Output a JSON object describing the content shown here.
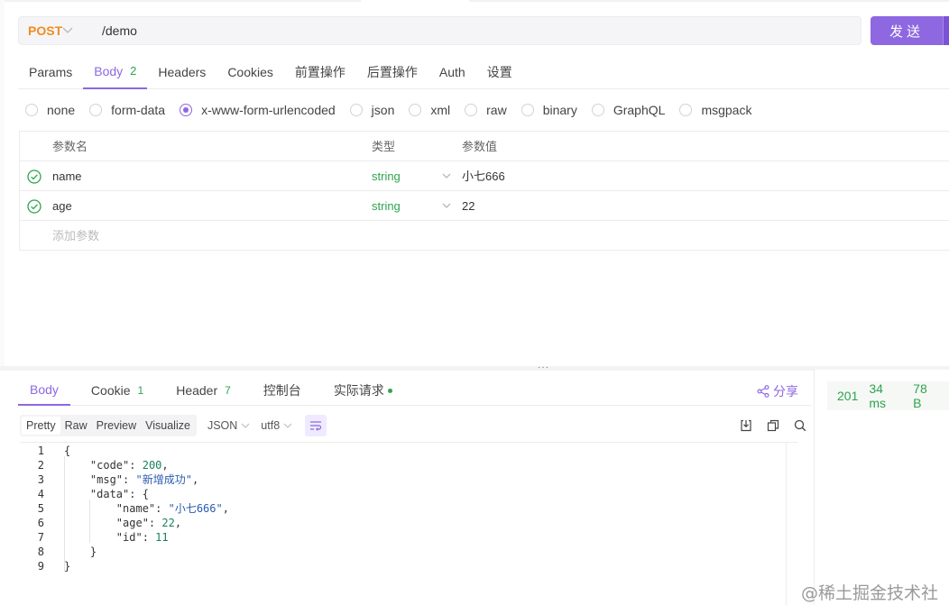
{
  "request": {
    "method": "POST",
    "url": "/demo",
    "send_label": "发送"
  },
  "req_tabs": [
    {
      "label": "Params",
      "count": ""
    },
    {
      "label": "Body",
      "count": "2",
      "active": true
    },
    {
      "label": "Headers",
      "count": ""
    },
    {
      "label": "Cookies",
      "count": ""
    },
    {
      "label": "前置操作",
      "count": ""
    },
    {
      "label": "后置操作",
      "count": ""
    },
    {
      "label": "Auth",
      "count": ""
    },
    {
      "label": "设置",
      "count": ""
    }
  ],
  "body_types": [
    "none",
    "form-data",
    "x-www-form-urlencoded",
    "json",
    "xml",
    "raw",
    "binary",
    "GraphQL",
    "msgpack"
  ],
  "body_type_selected": "x-www-form-urlencoded",
  "params_table": {
    "headers": {
      "name": "参数名",
      "type": "类型",
      "value": "参数值"
    },
    "rows": [
      {
        "name": "name",
        "type": "string",
        "value": "小七666"
      },
      {
        "name": "age",
        "type": "string",
        "value": "22"
      }
    ],
    "add_placeholder": "添加参数"
  },
  "res_tabs": [
    {
      "label": "Body",
      "count": "",
      "active": true
    },
    {
      "label": "Cookie",
      "count": "1"
    },
    {
      "label": "Header",
      "count": "7"
    },
    {
      "label": "控制台",
      "count": ""
    },
    {
      "label": "实际请求",
      "count": "",
      "dot": true
    }
  ],
  "share_label": "分享",
  "status": {
    "code": "201",
    "time": "34 ms",
    "size": "78 B"
  },
  "view_modes": [
    "Pretty",
    "Raw",
    "Preview",
    "Visualize"
  ],
  "view_mode_selected": "Pretty",
  "format_select": "JSON",
  "encoding_select": "utf8",
  "code_lines": [
    {
      "n": "1",
      "indent": 0,
      "text": "{"
    },
    {
      "n": "2",
      "indent": 1,
      "key": "\"code\"",
      "val": "200",
      "vtype": "num",
      "tail": ","
    },
    {
      "n": "3",
      "indent": 1,
      "key": "\"msg\"",
      "val": "\"新增成功\"",
      "vtype": "str",
      "tail": ","
    },
    {
      "n": "4",
      "indent": 1,
      "key": "\"data\"",
      "val": "{",
      "vtype": "punc",
      "tail": ""
    },
    {
      "n": "5",
      "indent": 2,
      "key": "\"name\"",
      "val": "\"小七666\"",
      "vtype": "str",
      "tail": ","
    },
    {
      "n": "6",
      "indent": 2,
      "key": "\"age\"",
      "val": "22",
      "vtype": "num",
      "tail": ","
    },
    {
      "n": "7",
      "indent": 2,
      "key": "\"id\"",
      "val": "11",
      "vtype": "num",
      "tail": ""
    },
    {
      "n": "8",
      "indent": 1,
      "text": "}"
    },
    {
      "n": "9",
      "indent": 0,
      "text": "}"
    }
  ],
  "watermark": "@稀土掘金技术社区",
  "colors": {
    "accent": "#8d68e1",
    "success": "#2ea44f",
    "method_post": "#f28c1d",
    "string": "#2a5db0"
  }
}
